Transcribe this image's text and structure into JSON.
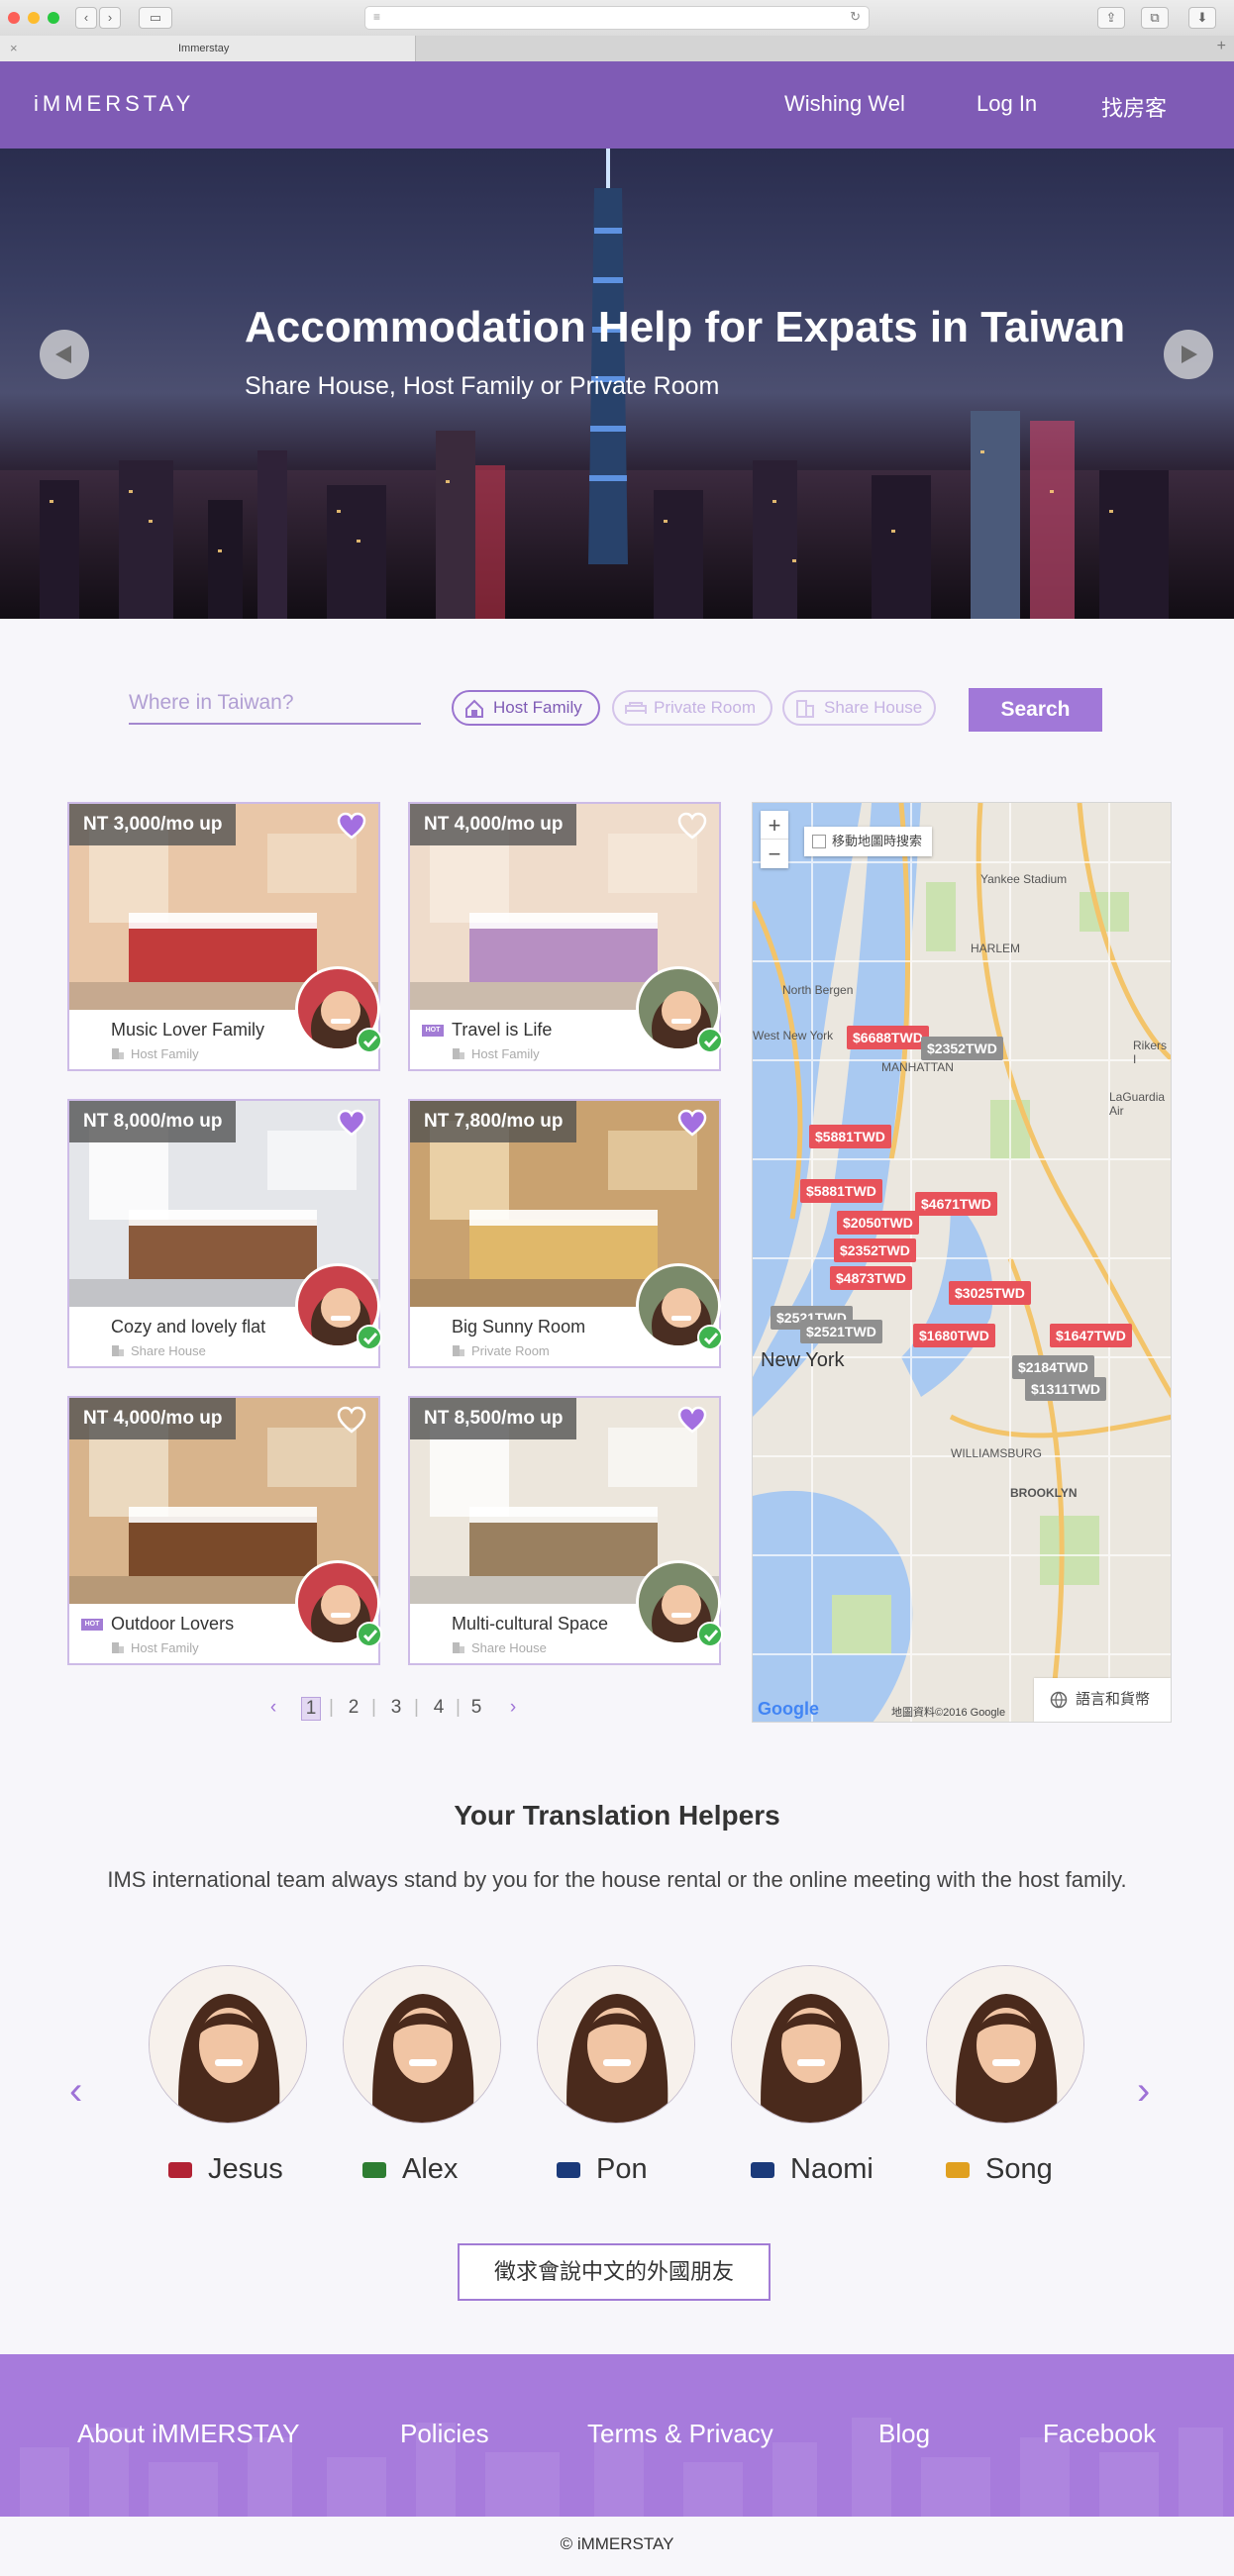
{
  "browser": {
    "tab_title": "Immerstay"
  },
  "header": {
    "logo": "iMMERSTAY",
    "nav": [
      "Wishing Wel",
      "Log In",
      "找房客"
    ]
  },
  "hero": {
    "title": "Accommodation Help for Expats in Taiwan",
    "subtitle": "Share House, Host Family or Private Room"
  },
  "search": {
    "placeholder": "Where in Taiwan?",
    "filters": [
      {
        "label": "Host Family",
        "active": true
      },
      {
        "label": "Private Room",
        "active": false
      },
      {
        "label": "Share House",
        "active": false
      }
    ],
    "button": "Search"
  },
  "listings": [
    {
      "price": "NT 3,000/mo up",
      "title": "Music Lover Family",
      "type": "Host Family",
      "favorite": true,
      "hot": false
    },
    {
      "price": "NT 4,000/mo up",
      "title": "Travel is Life",
      "type": "Host Family",
      "favorite": false,
      "hot": true
    },
    {
      "price": "NT 8,000/mo up",
      "title": "Cozy and lovely flat",
      "type": "Share House",
      "favorite": true,
      "hot": false
    },
    {
      "price": "NT 7,800/mo up",
      "title": "Big Sunny Room",
      "type": "Private Room",
      "favorite": true,
      "hot": false
    },
    {
      "price": "NT 4,000/mo up",
      "title": "Outdoor Lovers",
      "type": "Host Family",
      "favorite": false,
      "hot": true
    },
    {
      "price": "NT 8,500/mo up",
      "title": "Multi-cultural Space",
      "type": "Share House",
      "favorite": true,
      "hot": false
    }
  ],
  "map": {
    "checkbox_label": "移動地圖時搜索",
    "zoom_in": "+",
    "zoom_out": "−",
    "lang_button": "語言和貨幣",
    "attribution": "地圖資料©2016 Google",
    "google": "Google",
    "labels": [
      "New York",
      "MANHATTAN",
      "BROOKLYN",
      "North Bergen",
      "West New York",
      "Yankee Stadium",
      "HARLEM",
      "Rikers I",
      "LaGuardia Air",
      "WILLIAMSBURG"
    ],
    "price_tags": [
      {
        "text": "$6688TWD",
        "color": "red"
      },
      {
        "text": "$2352TWD",
        "color": "gray"
      },
      {
        "text": "$5881TWD",
        "color": "red"
      },
      {
        "text": "$5881TWD",
        "color": "red"
      },
      {
        "text": "$4671TWD",
        "color": "red"
      },
      {
        "text": "$2050TWD",
        "color": "red"
      },
      {
        "text": "$2352TWD",
        "color": "red"
      },
      {
        "text": "$4873TWD",
        "color": "red"
      },
      {
        "text": "$3025TWD",
        "color": "red"
      },
      {
        "text": "$2521TWD",
        "color": "gray"
      },
      {
        "text": "$2521TWD",
        "color": "gray"
      },
      {
        "text": "$1680TWD",
        "color": "red"
      },
      {
        "text": "$1647TWD",
        "color": "red"
      },
      {
        "text": "$2184TWD",
        "color": "gray"
      },
      {
        "text": "$1311TWD",
        "color": "gray"
      }
    ]
  },
  "pagination": {
    "prev": "‹",
    "pages": [
      "1",
      "2",
      "3",
      "4",
      "5"
    ],
    "current": "1",
    "next": "›"
  },
  "helpers": {
    "title": "Your Translation Helpers",
    "description": "IMS international team always stand by you for the house rental or the online meeting with the host family.",
    "people": [
      {
        "name": "Jesus",
        "flag_color": "#b22234"
      },
      {
        "name": "Alex",
        "flag_color": "#2e7d32"
      },
      {
        "name": "Pon",
        "flag_color": "#1b3a7a"
      },
      {
        "name": "Naomi",
        "flag_color": "#1b3a7a"
      },
      {
        "name": "Song",
        "flag_color": "#e0a020"
      }
    ],
    "prev": "‹",
    "next": "›",
    "cta": "徵求會說中文的外國朋友"
  },
  "footer": {
    "links": [
      "About iMMERSTAY",
      "Policies",
      "Terms & Privacy",
      "Blog",
      "Facebook"
    ],
    "copyright": "© iMMERSTAY"
  },
  "colors": {
    "brand": "#7f5bb5",
    "accent": "#a178d8",
    "footer": "#a77bdc",
    "map_red": "#e8525a"
  }
}
